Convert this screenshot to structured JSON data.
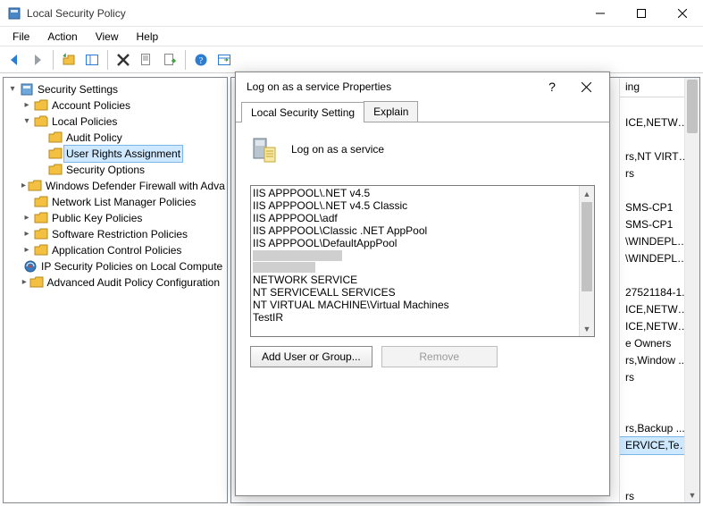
{
  "window": {
    "title": "Local Security Policy"
  },
  "menus": [
    "File",
    "Action",
    "View",
    "Help"
  ],
  "tree": {
    "root_label": "Security Settings",
    "nodes": [
      {
        "label": "Account Policies",
        "expandable": true,
        "expanded": false
      },
      {
        "label": "Local Policies",
        "expandable": true,
        "expanded": true,
        "children": [
          {
            "label": "Audit Policy"
          },
          {
            "label": "User Rights Assignment",
            "selected": true
          },
          {
            "label": "Security Options"
          }
        ]
      },
      {
        "label": "Windows Defender Firewall with Adva",
        "expandable": true,
        "expanded": false
      },
      {
        "label": "Network List Manager Policies",
        "expandable": false
      },
      {
        "label": "Public Key Policies",
        "expandable": true,
        "expanded": false
      },
      {
        "label": "Software Restriction Policies",
        "expandable": true,
        "expanded": false
      },
      {
        "label": "Application Control Policies",
        "expandable": true,
        "expanded": false
      },
      {
        "label": "IP Security Policies on Local Compute",
        "expandable": false,
        "icon": "ipsec"
      },
      {
        "label": "Advanced Audit Policy Configuration",
        "expandable": true,
        "expanded": false
      }
    ]
  },
  "list": {
    "header": "ing",
    "rows": [
      "",
      "ICE,NETWO...",
      "",
      "rs,NT VIRTU...",
      "rs",
      "",
      "SMS-CP1",
      "SMS-CP1",
      "\\WINDEPLO...",
      "\\WINDEPLO...",
      "",
      "27521184-1...",
      "ICE,NETWO...",
      "ICE,NETWO...",
      "e Owners",
      "rs,Window ...",
      "rs",
      "",
      "",
      "rs,Backup ...",
      "ERVICE,TestI...",
      "",
      "",
      "rs"
    ],
    "selected_index": 20
  },
  "dialog": {
    "title": "Log on as a service Properties",
    "tabs": [
      "Local Security Setting",
      "Explain"
    ],
    "active_tab": 0,
    "policy_label": "Log on as a service",
    "members": [
      "IIS APPPOOL\\.NET v4.5",
      "IIS APPPOOL\\.NET v4.5 Classic",
      "IIS APPPOOL\\adf",
      "IIS APPPOOL\\Classic .NET AppPool",
      "IIS APPPOOL\\DefaultAppPool",
      null,
      null,
      "NETWORK SERVICE",
      "NT SERVICE\\ALL SERVICES",
      "NT VIRTUAL MACHINE\\Virtual Machines",
      "TestIR"
    ],
    "add_button": "Add User or Group...",
    "remove_button": "Remove"
  }
}
